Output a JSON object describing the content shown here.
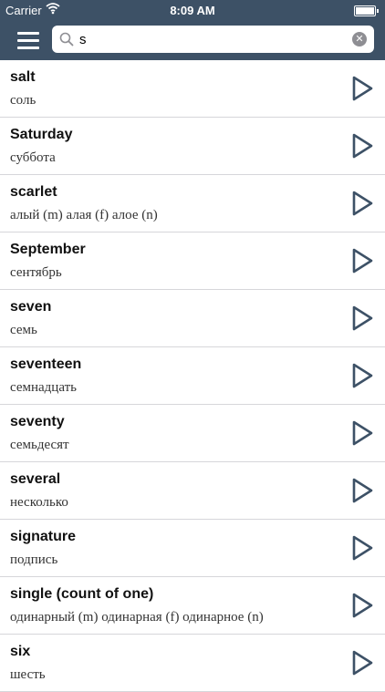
{
  "status": {
    "carrier": "Carrier",
    "time": "8:09 AM"
  },
  "search": {
    "value": "s",
    "placeholder": ""
  },
  "entries": [
    {
      "word": "salt",
      "translation": "соль"
    },
    {
      "word": "Saturday",
      "translation": "суббота"
    },
    {
      "word": "scarlet",
      "translation": "алый (m)  алая (f)  алое (n)"
    },
    {
      "word": "September",
      "translation": "сентябрь"
    },
    {
      "word": "seven",
      "translation": "семь"
    },
    {
      "word": "seventeen",
      "translation": "семнадцать"
    },
    {
      "word": "seventy",
      "translation": "семьдесят"
    },
    {
      "word": "several",
      "translation": "несколько"
    },
    {
      "word": "signature",
      "translation": "подпись"
    },
    {
      "word": "single (count of one)",
      "translation": "одинарный (m)  одинарная (f)  одинарное (n)"
    },
    {
      "word": "six",
      "translation": "шесть"
    }
  ],
  "colors": {
    "nav_background": "#3d5166",
    "icon_stroke": "#3d5166",
    "separator": "#d6d6da"
  },
  "icons": {
    "menu": "hamburger-icon",
    "search": "magnifier-icon",
    "clear": "clear-circle-icon",
    "play": "play-triangle-icon"
  }
}
